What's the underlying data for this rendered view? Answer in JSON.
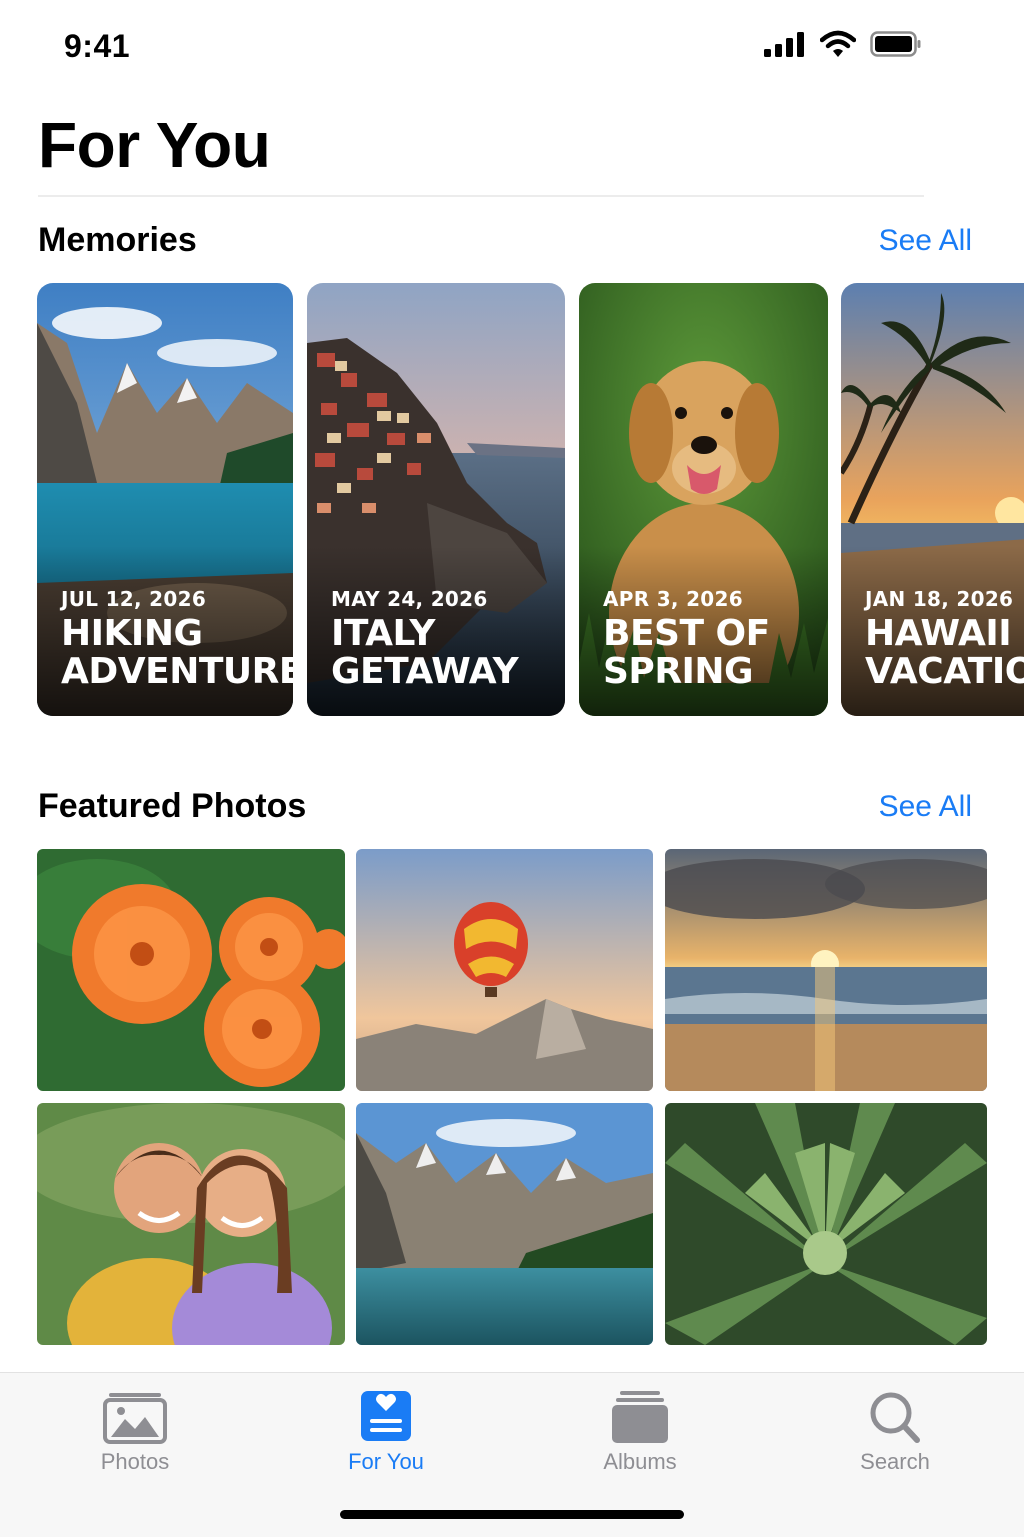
{
  "status_bar": {
    "time": "9:41"
  },
  "page": {
    "title": "For You"
  },
  "memories": {
    "heading": "Memories",
    "see_all": "See All",
    "cards": [
      {
        "date": "JUL 12, 2026",
        "title": "HIKING ADVENTURES",
        "scene": "mountain lake"
      },
      {
        "date": "MAY 24, 2026",
        "title": "ITALY GETAWAY",
        "scene": "coastal village"
      },
      {
        "date": "APR 3, 2026",
        "title": "BEST OF SPRING",
        "scene": "golden retriever"
      },
      {
        "date": "JAN 18, 2026",
        "title": "HAWAII VACATION",
        "scene": "palm beach sunset"
      }
    ]
  },
  "featured": {
    "heading": "Featured Photos",
    "see_all": "See All",
    "photos": [
      {
        "scene": "orange dahlias"
      },
      {
        "scene": "hot air balloon"
      },
      {
        "scene": "ocean sunset"
      },
      {
        "scene": "two children"
      },
      {
        "scene": "mountain lake"
      },
      {
        "scene": "succulent plant"
      }
    ]
  },
  "tab_bar": {
    "tabs": [
      {
        "label": "Photos",
        "icon": "photos-icon",
        "active": false
      },
      {
        "label": "For You",
        "icon": "for-you-icon",
        "active": true
      },
      {
        "label": "Albums",
        "icon": "albums-icon",
        "active": false
      },
      {
        "label": "Search",
        "icon": "search-icon",
        "active": false
      }
    ]
  },
  "colors": {
    "accent": "#1a7cf5",
    "inactive": "#8e8e93"
  }
}
